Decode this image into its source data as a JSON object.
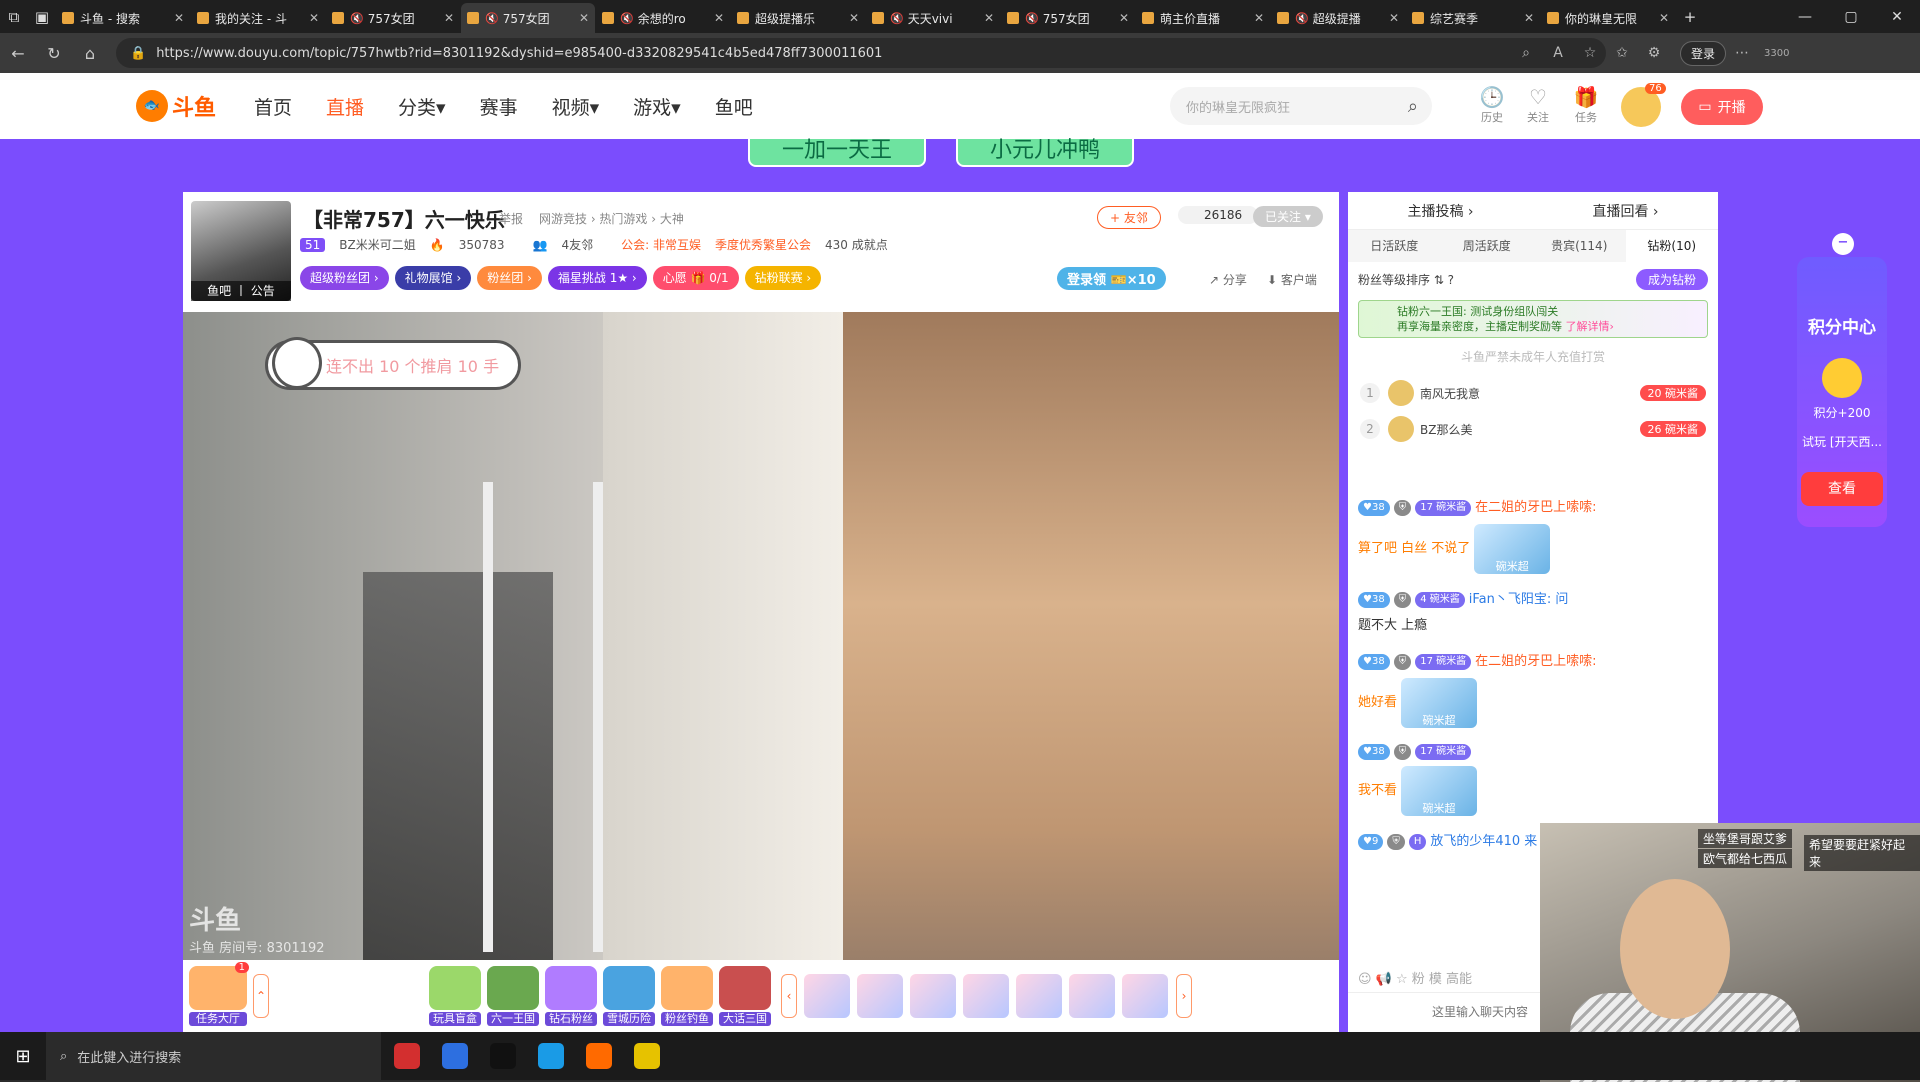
{
  "browser": {
    "tabs": [
      {
        "label": "斗鱼 - 搜索",
        "muted": false,
        "active": false
      },
      {
        "label": "我的关注 - 斗",
        "muted": false,
        "active": false
      },
      {
        "label": "757女团",
        "muted": true,
        "active": false
      },
      {
        "label": "757女团",
        "muted": true,
        "active": true
      },
      {
        "label": "余想的ro",
        "muted": true,
        "active": false
      },
      {
        "label": "超级提播乐",
        "muted": false,
        "active": false
      },
      {
        "label": "天天vivi",
        "muted": true,
        "active": false
      },
      {
        "label": "757女团",
        "muted": true,
        "active": false
      },
      {
        "label": "萌主价直播",
        "muted": false,
        "active": false
      },
      {
        "label": "超级提播",
        "muted": true,
        "active": false
      },
      {
        "label": "综艺赛季",
        "muted": false,
        "active": false
      },
      {
        "label": "你的琳皇无限",
        "muted": false,
        "active": false
      }
    ],
    "url": "https://www.douyu.com/topic/757hwtb?rid=8301192&dyshid=e985400-d3320829541c4b5ed478ff7300011601",
    "login_label": "登录",
    "tray_count": "3300"
  },
  "site": {
    "logo_text": "斗鱼",
    "nav": [
      {
        "label": "首页",
        "active": false
      },
      {
        "label": "直播",
        "active": true
      },
      {
        "label": "分类▾",
        "active": false
      },
      {
        "label": "赛事",
        "active": false
      },
      {
        "label": "视频▾",
        "active": false
      },
      {
        "label": "游戏▾",
        "active": false
      },
      {
        "label": "鱼吧",
        "active": false
      }
    ],
    "search_placeholder": "你的琳皇无限疯狂",
    "icons": [
      {
        "icon": "history-icon",
        "label": "历史"
      },
      {
        "icon": "heart-icon",
        "label": "关注"
      },
      {
        "icon": "gift-box-icon",
        "label": "任务"
      }
    ],
    "user_badge": "76",
    "open_live_label": "开播"
  },
  "promo": {
    "left": "一加一天王",
    "right": "小元儿冲鸭"
  },
  "room": {
    "avatar_caption": "鱼吧 丨 公告",
    "title": "【非常757】六一快乐",
    "report": "举报",
    "categories": "网游竞技 › 热门游戏 › 大神",
    "level": "51",
    "anchor": "BZ米米可二姐",
    "hot": "350783",
    "friends": "4友邻",
    "guild": "公会: 非常互娱",
    "guild_tag": "季度优秀繁星公会",
    "growth": "430 成就点",
    "pills": [
      {
        "label": "超级粉丝团 ›",
        "color": "#8a46e8"
      },
      {
        "label": "礼物展馆 ›",
        "color": "#3a3da8"
      },
      {
        "label": "粉丝团 ›",
        "color": "#ff8a3d"
      },
      {
        "label": "福星挑战 1★ ›",
        "color": "#7b35e6"
      },
      {
        "label": "心愿 🎁 0/1",
        "color": "#ff4d6d"
      },
      {
        "label": "钻粉联赛 ›",
        "color": "#f5b400"
      }
    ],
    "add_friend": "+ 友邻",
    "follow_count": "26186",
    "followed": "已关注 ▾",
    "login_reward": "登录领 🎫×10",
    "share": "分享",
    "client": "客户端"
  },
  "video": {
    "bubble": "连不出 10 个推肩 10 手",
    "watermark_logo": "斗鱼",
    "watermark_room": "斗鱼 房间号: 8301192"
  },
  "giftbar": {
    "lobby": {
      "label": "任务大厅",
      "badge": "1"
    },
    "games": [
      {
        "label": "玩具盲盒",
        "color": "#9bd86a"
      },
      {
        "label": "六一王国",
        "color": "#6aa84f"
      },
      {
        "label": "钻石粉丝",
        "color": "#b07cff"
      },
      {
        "label": "雪城历险",
        "color": "#4aa3e0"
      },
      {
        "label": "粉丝钓鱼",
        "color": "#ffb36b"
      },
      {
        "label": "大话三国",
        "color": "#c94f4f"
      }
    ],
    "faces": [
      "face-gift-1",
      "face-gift-2",
      "face-gift-3",
      "face-gift-4",
      "face-gift-5",
      "face-gift-6",
      "face-gift-7"
    ]
  },
  "chat": {
    "top_left": "主播投稿 ›",
    "top_right": "直播回看 ›",
    "tabs": [
      {
        "label": "日活跃度",
        "on": false
      },
      {
        "label": "周活跃度",
        "on": false
      },
      {
        "label": "贵宾(114)",
        "on": false
      },
      {
        "label": "钻粉(10)",
        "on": true
      }
    ],
    "fan_sort": "粉丝等级排序 ⇅ ?",
    "fan_button": "成为钻粉",
    "banner_title": "钻粉六一王国: 测试身份组队闯关",
    "banner_sub": "再享海量亲密度，主播定制奖励等",
    "banner_link": "了解详情›",
    "no_charge": "斗鱼严禁未成年人充值打赏",
    "ranks": [
      {
        "num": "1",
        "name": "南风无我意",
        "badge": "20 碗米酱"
      },
      {
        "num": "2",
        "name": "BZ那么美",
        "badge": "26 碗米酱"
      }
    ],
    "messages": [
      {
        "lv": "38",
        "fan": "17 碗米酱",
        "name": "在二姐的牙巴上嗦嗦:",
        "text": "算了吧 白丝 不说了",
        "emoji": "碗米超",
        "blue": false
      },
      {
        "lv": "38",
        "fan": "4 碗米酱",
        "name": "iFan丶飞阳宝: 问",
        "text": "题不大 上瘾",
        "emoji": "",
        "blue": true
      },
      {
        "lv": "38",
        "fan": "17 碗米酱",
        "name": "在二姐的牙巴上嗦嗦:",
        "text": "她好看",
        "emoji": "碗米超",
        "blue": false
      },
      {
        "lv": "38",
        "fan": "17 碗米酱",
        "name": "",
        "text": "我不看",
        "emoji": "碗米超",
        "blue": false
      },
      {
        "lv": "9",
        "fan": "H",
        "name": "放飞的少年410 来",
        "text": "",
        "emoji": "",
        "blue": true
      }
    ],
    "tools": "☺ 📢 ☆ 粉 模 高能",
    "input_placeholder": "这里输入聊天内容"
  },
  "points_panel": {
    "title": "积分中心",
    "points": "积分+200",
    "trial": "试玩 [开天西...",
    "button": "查看"
  },
  "webcam": {
    "cap1": "坐等堡哥跟艾爹",
    "cap2": "欧气都给七西瓜",
    "cap3": "希望要要赶紧好起来"
  },
  "taskbar": {
    "search_placeholder": "在此键入进行搜索",
    "apps": [
      {
        "icon": "app-64-icon",
        "color": "#d32f2f"
      },
      {
        "icon": "app-blue-icon",
        "color": "#2d6fe0"
      },
      {
        "icon": "tiktok-icon",
        "color": "#111"
      },
      {
        "icon": "edge-icon",
        "color": "#1a9be6"
      },
      {
        "icon": "douyu-icon",
        "color": "#ff6a00"
      },
      {
        "icon": "app-ring-icon",
        "color": "#e6c200"
      }
    ]
  }
}
